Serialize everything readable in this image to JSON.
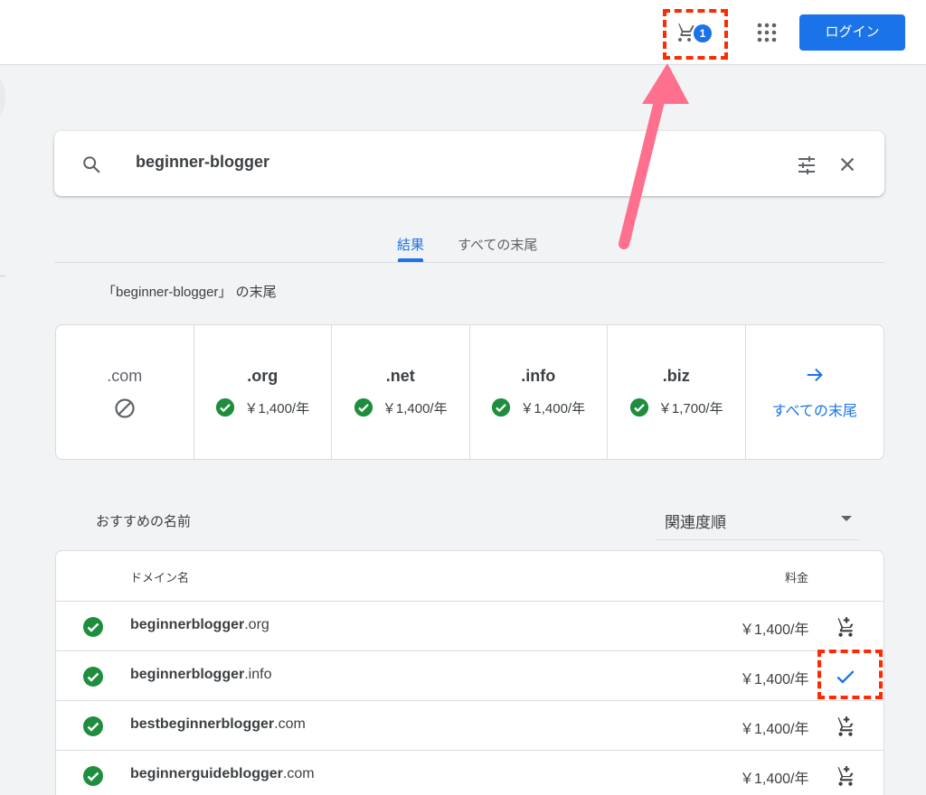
{
  "header": {
    "cart_count": "1",
    "login_label": "ログイン"
  },
  "search": {
    "query": "beginner-blogger"
  },
  "tabs": [
    {
      "label": "結果"
    },
    {
      "label": "すべての末尾"
    }
  ],
  "suffix_heading": "「beginner-blogger」 の末尾",
  "tlds": [
    {
      "name": ".com",
      "status": "unavailable",
      "price": ""
    },
    {
      "name": ".org",
      "status": "available",
      "price": "￥1,400/年"
    },
    {
      "name": ".net",
      "status": "available",
      "price": "￥1,400/年"
    },
    {
      "name": ".info",
      "status": "available",
      "price": "￥1,400/年"
    },
    {
      "name": ".biz",
      "status": "available",
      "price": "￥1,700/年"
    }
  ],
  "all_suffix_label": "すべての末尾",
  "recommended": {
    "heading": "おすすめの名前",
    "sort_label": "関連度順",
    "col_domain": "ドメイン名",
    "col_price": "料金",
    "rows": [
      {
        "name": "beginnerblogger",
        "tld": ".org",
        "price": "￥1,400/年",
        "in_cart": false
      },
      {
        "name": "beginnerblogger",
        "tld": ".info",
        "price": "￥1,400/年",
        "in_cart": true
      },
      {
        "name": "bestbeginnerblogger",
        "tld": ".com",
        "price": "￥1,400/年",
        "in_cart": false
      },
      {
        "name": "beginnerguideblogger",
        "tld": ".com",
        "price": "￥1,400/年",
        "in_cart": false
      }
    ]
  },
  "colors": {
    "accent": "#1a73e8",
    "success": "#1e8e3e",
    "highlight": "#ff2a00",
    "annotation_arrow": "#ff6f8e"
  }
}
